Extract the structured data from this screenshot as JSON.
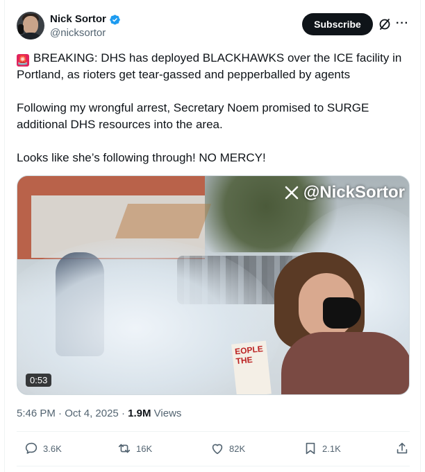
{
  "author": {
    "name": "Nick Sortor",
    "handle": "@nicksortor"
  },
  "header": {
    "subscribe_label": "Subscribe",
    "grok_icon": "grok-icon",
    "more_icon": "more-icon"
  },
  "tweet": {
    "line1_emoji": "🚨",
    "line1": "BREAKING: DHS has deployed BLACKHAWKS over the ICE facility in Portland, as rioters get tear-gassed and pepperballed by agents",
    "line2": "Following my wrongful arrest, Secretary Noem promised to SURGE additional DHS resources into the area.",
    "line3": "Looks like she’s following through! NO MERCY!"
  },
  "media": {
    "watermark": "@NickSortor",
    "duration": "0:53",
    "sign_text": "EOPLE THE"
  },
  "meta": {
    "time": "5:46 PM",
    "date": "Oct 4, 2025",
    "views_count": "1.9M",
    "views_label": "Views"
  },
  "actions": {
    "replies": "3.6K",
    "reposts": "16K",
    "likes": "82K",
    "bookmarks": "2.1K"
  },
  "colors": {
    "accent": "#1d9bf0",
    "text": "#0f1419",
    "muted": "#536471"
  }
}
